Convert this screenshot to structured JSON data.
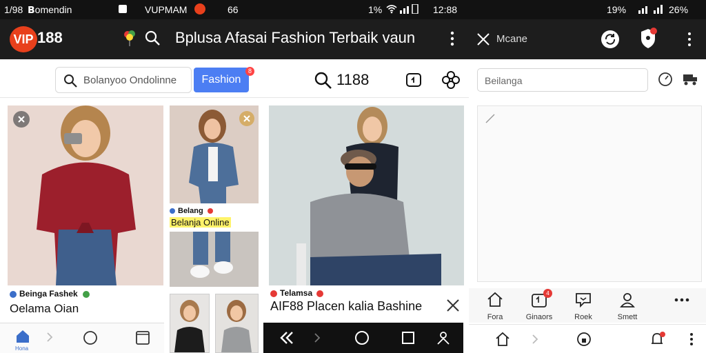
{
  "status_bar": {
    "left_time": "1/98",
    "left_text": "𝗕omendin",
    "carrier": "VUPMAM",
    "mid_num": "66",
    "battery_left": "1%",
    "time_left": "12:88",
    "battery_right": "19%",
    "time_right": "26%"
  },
  "header": {
    "logo_badge": "VIP",
    "logo_number": "188",
    "title": "Bplusa Afasai Fashion Terbaik vaun"
  },
  "header_right": {
    "label": "Mcane"
  },
  "search": {
    "placeholder": "Bolanyoo Ondolinne",
    "chip_label": "Fashion",
    "chip_badge": "8",
    "counter": "1188"
  },
  "cards": {
    "card1_tag": "Beinga Fashek",
    "card1_title": "Oelama Oian",
    "card2_tag": "Belang",
    "card2_title": "Belanja Online",
    "card4_tag": "Telamsa",
    "card4_title": "AIF88 Placen kalia Bashine"
  },
  "right_panel": {
    "input_placeholder": "Beilanga",
    "tabs": [
      {
        "label": "Fora",
        "icon": "home-outline-icon"
      },
      {
        "label": "Ginaors",
        "icon": "bag-icon",
        "badge": "4"
      },
      {
        "label": "Roek",
        "icon": "chat-icon"
      },
      {
        "label": "Smett",
        "icon": "profile-icon"
      },
      {
        "label": "",
        "icon": "more-icon"
      }
    ]
  },
  "nav": {
    "home_label": "Hona"
  },
  "colors": {
    "header_bg": "#1d1d1d",
    "brand": "#e8401c",
    "chip": "#4c7ef3",
    "highlight": "#fff36a",
    "badge": "#e53935",
    "card1_shirt": "#9c1f2c"
  }
}
